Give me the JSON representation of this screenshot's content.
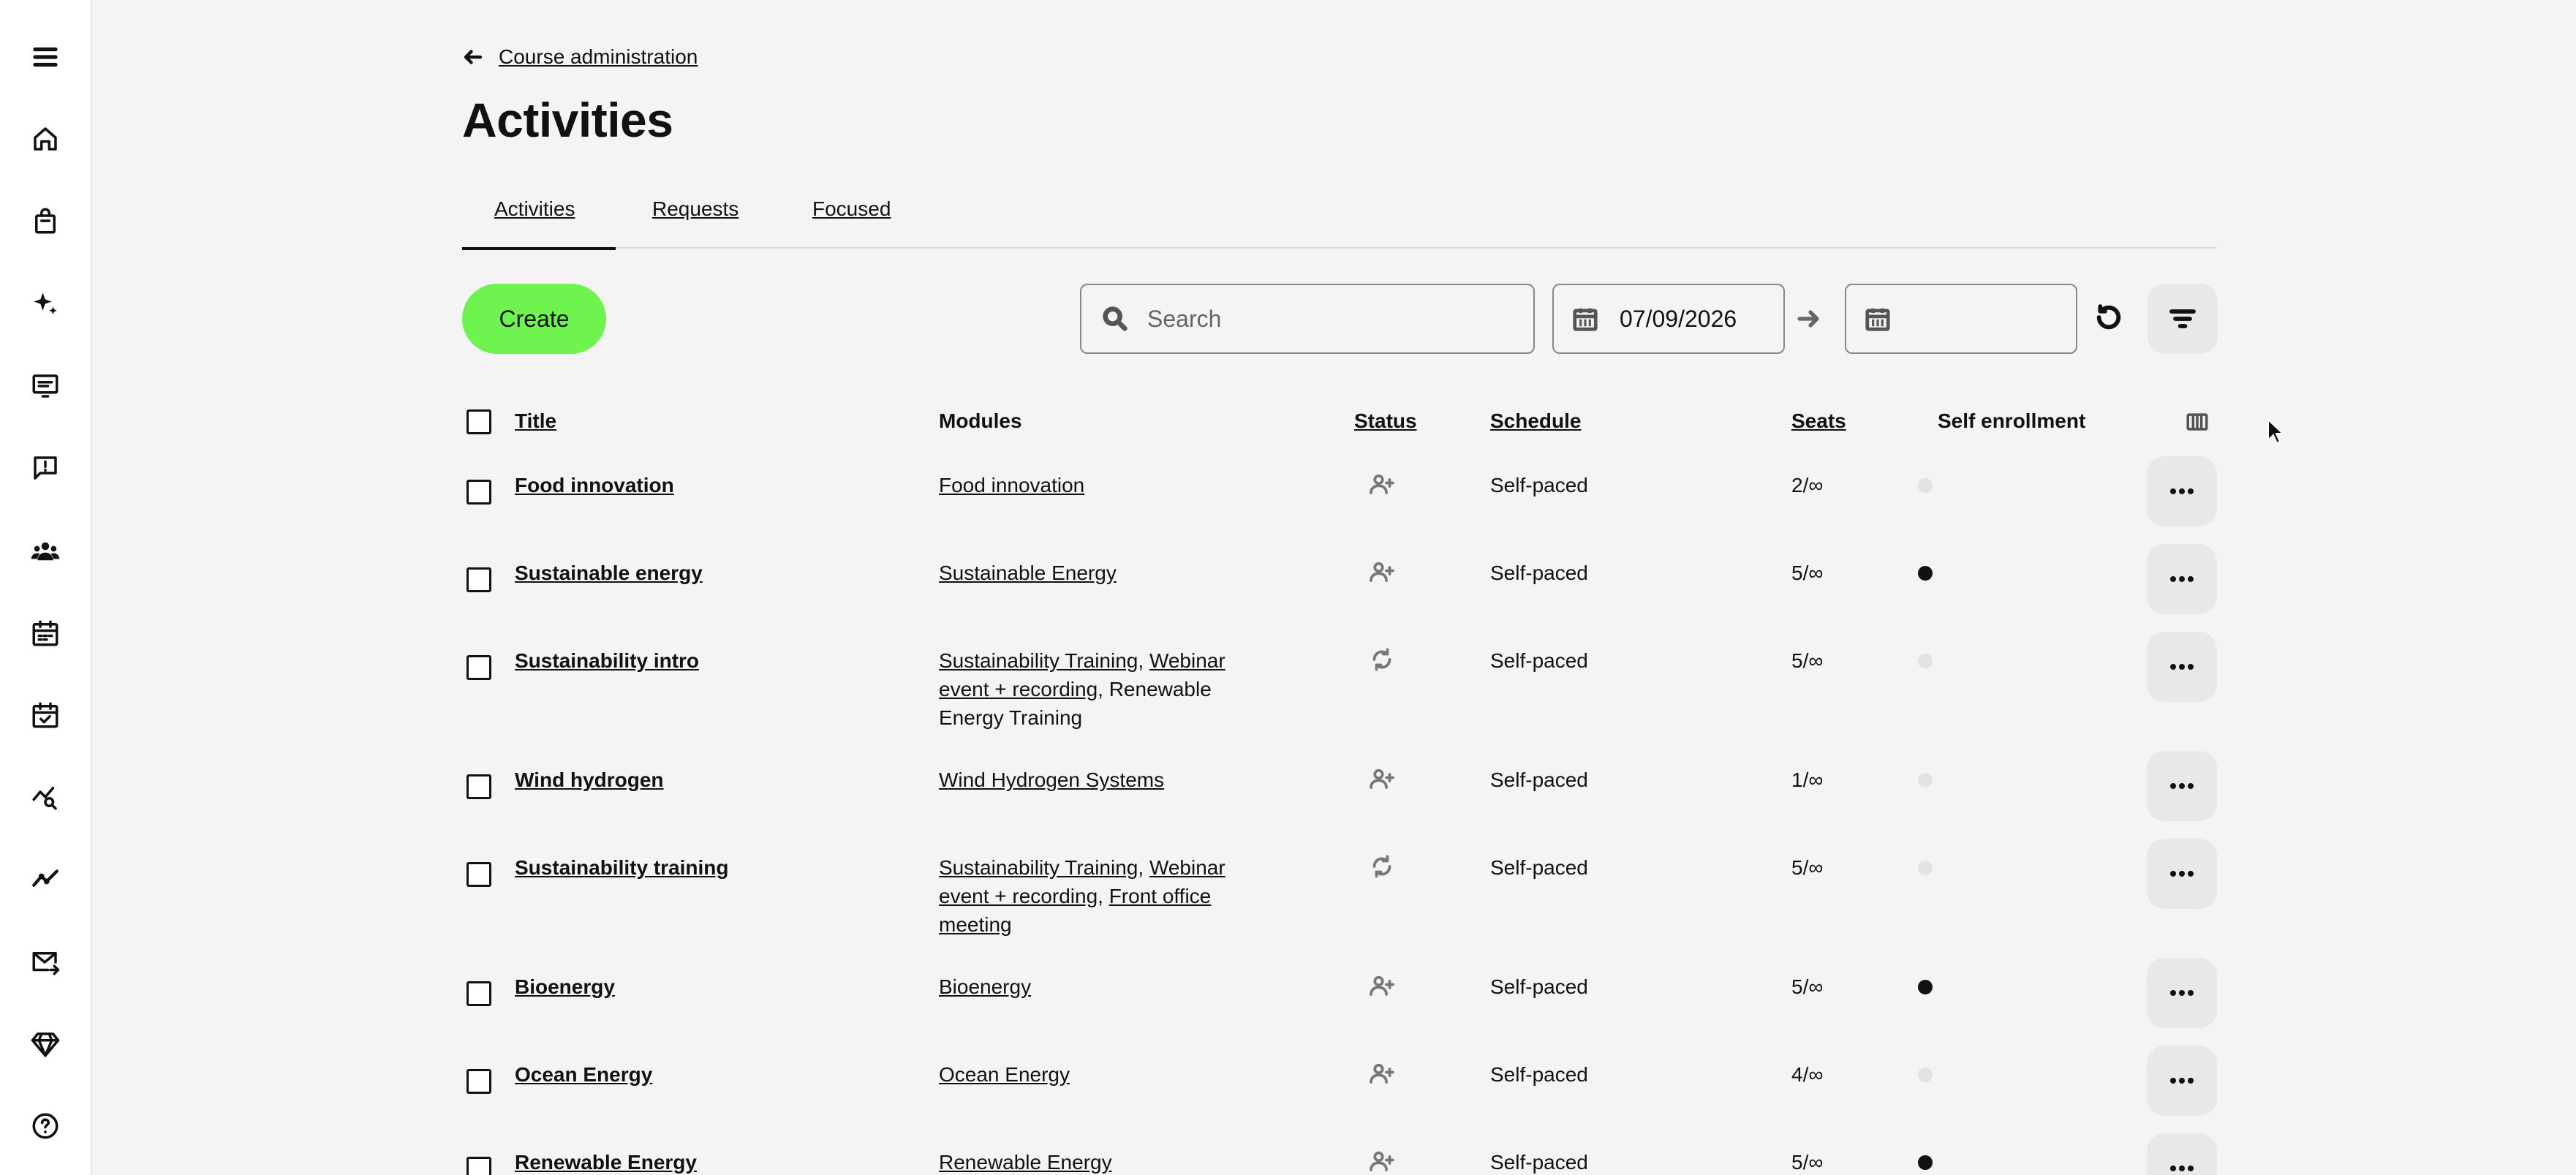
{
  "sidebar": {
    "items": [
      {
        "icon": "menu-icon"
      },
      {
        "icon": "home-icon"
      },
      {
        "icon": "shopping-bag-icon"
      },
      {
        "icon": "sparkles-icon"
      },
      {
        "icon": "presentation-icon"
      },
      {
        "icon": "feedback-icon"
      },
      {
        "icon": "users-icon"
      },
      {
        "icon": "calendar-icon"
      },
      {
        "icon": "calendar-check-icon"
      },
      {
        "icon": "analytics-search-icon"
      },
      {
        "icon": "trend-line-icon"
      },
      {
        "icon": "mail-send-icon"
      },
      {
        "icon": "diamond-icon"
      },
      {
        "icon": "help-icon"
      }
    ]
  },
  "header": {
    "back_label": "Course administration",
    "title": "Activities"
  },
  "tabs": [
    {
      "label": "Activities",
      "active": true
    },
    {
      "label": "Requests",
      "active": false
    },
    {
      "label": "Focused",
      "active": false
    }
  ],
  "toolbar": {
    "create_label": "Create",
    "search_placeholder": "Search",
    "date_from": "07/09/2026",
    "date_to": ""
  },
  "table": {
    "columns": {
      "title": "Title",
      "modules": "Modules",
      "status": "Status",
      "schedule": "Schedule",
      "seats": "Seats",
      "self_enrollment": "Self enrollment"
    },
    "rows": [
      {
        "title": "Food innovation",
        "modules": [
          {
            "text": "Food innovation",
            "link": true
          }
        ],
        "status": "add-user-icon",
        "schedule": "Self-paced",
        "seats": "2/∞",
        "self_enrollment": false
      },
      {
        "title": "Sustainable energy",
        "modules": [
          {
            "text": "Sustainable Energy",
            "link": true
          }
        ],
        "status": "add-user-icon",
        "schedule": "Self-paced",
        "seats": "5/∞",
        "self_enrollment": true
      },
      {
        "title": "Sustainability intro",
        "modules": [
          {
            "text": "Sustainability Training",
            "link": true
          },
          {
            "text": ", ",
            "link": false
          },
          {
            "text": "Webinar event + recording",
            "link": true
          },
          {
            "text": ", Renewable Energy Training",
            "link": false
          }
        ],
        "status": "sync-icon",
        "schedule": "Self-paced",
        "seats": "5/∞",
        "self_enrollment": false
      },
      {
        "title": "Wind hydrogen",
        "modules": [
          {
            "text": "Wind Hydrogen Systems",
            "link": true
          }
        ],
        "status": "add-user-icon",
        "schedule": "Self-paced",
        "seats": "1/∞",
        "self_enrollment": false
      },
      {
        "title": "Sustainability training",
        "modules": [
          {
            "text": "Sustainability Training",
            "link": true
          },
          {
            "text": ", ",
            "link": false
          },
          {
            "text": "Webinar event + recording",
            "link": true
          },
          {
            "text": ", ",
            "link": false
          },
          {
            "text": "Front office meeting",
            "link": true
          }
        ],
        "status": "sync-icon",
        "schedule": "Self-paced",
        "seats": "5/∞",
        "self_enrollment": false
      },
      {
        "title": "Bioenergy",
        "modules": [
          {
            "text": "Bioenergy",
            "link": true
          }
        ],
        "status": "add-user-icon",
        "schedule": "Self-paced",
        "seats": "5/∞",
        "self_enrollment": true
      },
      {
        "title": "Ocean Energy",
        "modules": [
          {
            "text": "Ocean Energy",
            "link": true
          }
        ],
        "status": "add-user-icon",
        "schedule": "Self-paced",
        "seats": "4/∞",
        "self_enrollment": false
      },
      {
        "title": "Renewable Energy",
        "modules": [
          {
            "text": "Renewable Energy",
            "link": true
          }
        ],
        "status": "add-user-icon",
        "schedule": "Self-paced",
        "seats": "5/∞",
        "self_enrollment": true
      }
    ]
  },
  "colors": {
    "accent": "#6ff44f",
    "background": "#f4f4f4",
    "enroll_on": "#111111",
    "enroll_off": "#e2e2e2"
  }
}
